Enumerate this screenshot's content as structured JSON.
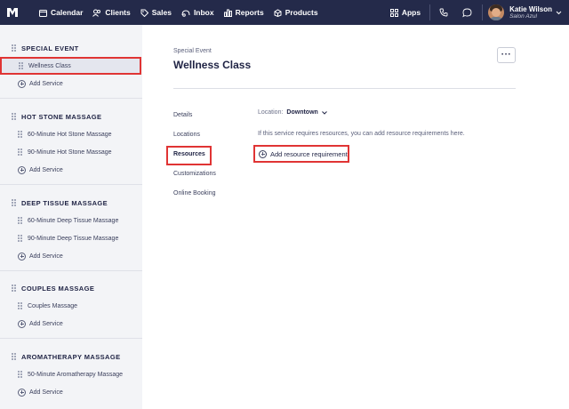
{
  "nav": {
    "items": [
      {
        "label": "Calendar",
        "icon": "calendar-icon"
      },
      {
        "label": "Clients",
        "icon": "clients-icon"
      },
      {
        "label": "Sales",
        "icon": "tag-icon"
      },
      {
        "label": "Inbox",
        "icon": "inbox-icon"
      },
      {
        "label": "Reports",
        "icon": "reports-icon"
      },
      {
        "label": "Products",
        "icon": "products-icon"
      }
    ],
    "apps_label": "Apps",
    "user": {
      "name": "Katie Wilson",
      "org": "Salon Azul"
    },
    "bg_color": "#242a4a",
    "highlight_color": "#e03434"
  },
  "sidebar": {
    "groups": [
      {
        "title": "SPECIAL EVENT",
        "services": [
          "Wellness Class"
        ],
        "add_label": "Add Service"
      },
      {
        "title": "HOT STONE MASSAGE",
        "services": [
          "60-Minute Hot Stone Massage",
          "90-Minute Hot Stone Massage"
        ],
        "add_label": "Add Service"
      },
      {
        "title": "DEEP TISSUE MASSAGE",
        "services": [
          "60-Minute Deep Tissue Massage",
          "90-Minute Deep Tissue Massage"
        ],
        "add_label": "Add Service"
      },
      {
        "title": "COUPLES MASSAGE",
        "services": [
          "Couples Massage"
        ],
        "add_label": "Add Service"
      },
      {
        "title": "AROMATHERAPY MASSAGE",
        "services": [
          "50-Minute Aromatherapy Massage"
        ],
        "add_label": "Add Service"
      }
    ]
  },
  "main": {
    "breadcrumb": "Special Event",
    "title": "Wellness Class",
    "more_label": "···",
    "tabs": [
      "Details",
      "Locations",
      "Resources",
      "Customizations",
      "Online Booking"
    ],
    "active_tab": "Resources",
    "location_label": "Location:",
    "location_value": "Downtown",
    "hint": "If this service requires resources, you can add resource requirements here.",
    "add_requirement_label": "Add resource requirement"
  }
}
